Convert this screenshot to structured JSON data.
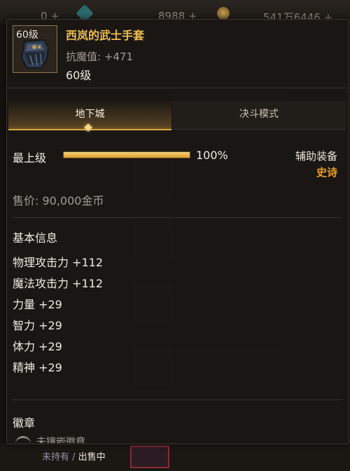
{
  "topbar": {
    "stat1": "0 +",
    "stat2": "8988 +",
    "stat3": "541万6446 +"
  },
  "item": {
    "name": "西岚的武士手套",
    "level_badge": "60级",
    "stat_line": "抗魔值: +471",
    "level_text": "60级",
    "icon": "gauntlet-icon"
  },
  "tabs": [
    {
      "label": "地下城",
      "active": true
    },
    {
      "label": "决斗模式",
      "active": false
    }
  ],
  "grade": {
    "label": "最上级",
    "percent_text": "100%",
    "fill": 1.0,
    "equip_type": "辅助装备",
    "rarity": "史诗",
    "rarity_color": "#f0a020"
  },
  "sell_price": "售价: 90,000金币",
  "basic_info": {
    "title": "基本信息",
    "stats": [
      "物理攻击力 +112",
      "魔法攻击力 +112",
      "力量 +29",
      "智力 +29",
      "体力 +29",
      "精神 +29"
    ]
  },
  "badge_section": {
    "title": "徽章",
    "row_text": "未镶嵌徽章"
  },
  "bottom": {
    "status_a": "未持有",
    "status_sep": " / ",
    "status_b": "出售中"
  },
  "colors": {
    "item_name": "#ecbd52",
    "accent_gold": "#d9a840"
  }
}
